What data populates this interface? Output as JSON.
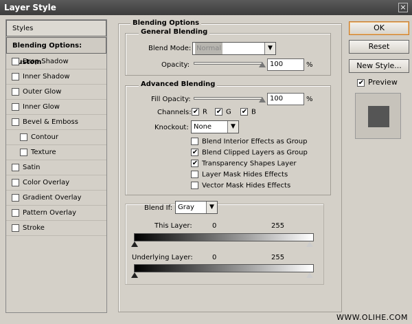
{
  "window": {
    "title": "Layer Style",
    "close_glyph": "×"
  },
  "sidebar": {
    "header": "Styles",
    "selected": "Blending Options: Custom",
    "items": [
      {
        "label": "Drop Shadow",
        "checked": false,
        "indent": false
      },
      {
        "label": "Inner Shadow",
        "checked": false,
        "indent": false
      },
      {
        "label": "Outer Glow",
        "checked": false,
        "indent": false
      },
      {
        "label": "Inner Glow",
        "checked": false,
        "indent": false
      },
      {
        "label": "Bevel & Emboss",
        "checked": false,
        "indent": false
      },
      {
        "label": "Contour",
        "checked": false,
        "indent": true
      },
      {
        "label": "Texture",
        "checked": false,
        "indent": true
      },
      {
        "label": "Satin",
        "checked": false,
        "indent": false
      },
      {
        "label": "Color Overlay",
        "checked": false,
        "indent": false
      },
      {
        "label": "Gradient Overlay",
        "checked": false,
        "indent": false
      },
      {
        "label": "Pattern Overlay",
        "checked": false,
        "indent": false
      },
      {
        "label": "Stroke",
        "checked": false,
        "indent": false
      }
    ]
  },
  "blending": {
    "title": "Blending Options",
    "general": {
      "title": "General Blending",
      "blend_mode_label": "Blend Mode:",
      "blend_mode_value": "Normal",
      "opacity_label": "Opacity:",
      "opacity_value": "100",
      "opacity_unit": "%",
      "opacity_level": 1.0
    },
    "advanced": {
      "title": "Advanced Blending",
      "fill_opacity_label": "Fill Opacity:",
      "fill_opacity_value": "100",
      "fill_opacity_unit": "%",
      "fill_opacity_level": 1.0,
      "channels_label": "Channels:",
      "channel_r": "R",
      "channel_g": "G",
      "channel_b": "B",
      "knockout_label": "Knockout:",
      "knockout_value": "None",
      "options": [
        {
          "label": "Blend Interior Effects as Group",
          "checked": false
        },
        {
          "label": "Blend Clipped Layers as Group",
          "checked": true
        },
        {
          "label": "Transparency Shapes Layer",
          "checked": true
        },
        {
          "label": "Layer Mask Hides Effects",
          "checked": false
        },
        {
          "label": "Vector Mask Hides Effects",
          "checked": false
        }
      ]
    },
    "blend_if": {
      "label": "Blend If:",
      "value": "Gray",
      "this_layer_label": "This Layer:",
      "this_layer_min": "0",
      "this_layer_max": "255",
      "underlying_label": "Underlying Layer:",
      "underlying_min": "0",
      "underlying_max": "255"
    }
  },
  "buttons": {
    "ok": "OK",
    "reset": "Reset",
    "new_style": "New Style..."
  },
  "preview": {
    "label": "Preview",
    "checked": true
  },
  "watermark": "WWW.OLIHE.COM",
  "colors": {
    "ok_border": "#c87a2a",
    "preview_swatch": "#555555"
  }
}
